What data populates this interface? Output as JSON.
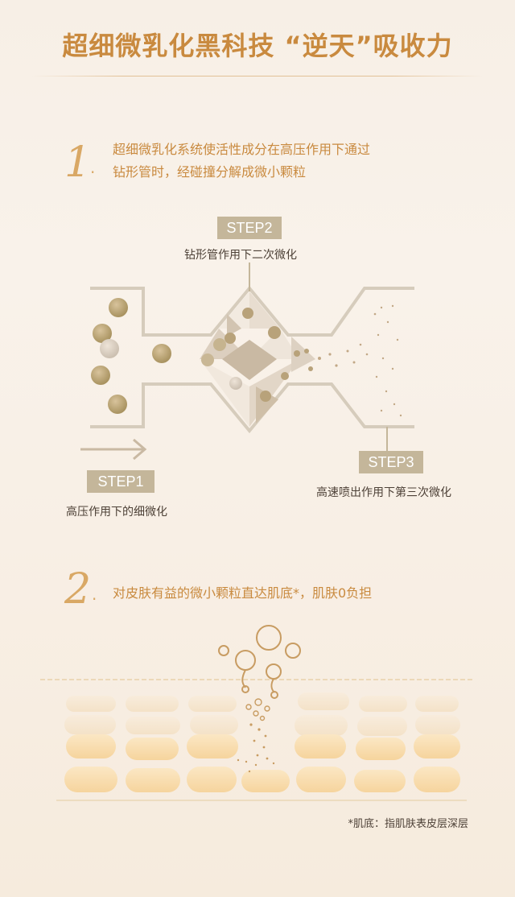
{
  "title": "超细微乳化黑科技 “逆天”吸收力",
  "section1": {
    "number": "1",
    "text_line1": "超细微乳化系统使活性成分在高压作用下通过",
    "text_line2": "钻形管时，经碰撞分解成微小颗粒"
  },
  "steps": {
    "step1": {
      "label": "STEP1",
      "desc": "高压作用下的细微化"
    },
    "step2": {
      "label": "STEP2",
      "desc": "钻形管作用下二次微化"
    },
    "step3": {
      "label": "STEP3",
      "desc": "高速喷出作用下第三次微化"
    }
  },
  "section2": {
    "number": "2",
    "text": "对皮肤有益的微小颗粒直达肌底*，肌肤0负担"
  },
  "footnote": "*肌底：指肌肤表皮层深层",
  "colors": {
    "accent": "#c98a3f",
    "number": "#d9a865",
    "step_label_bg": "#c4b69a",
    "particle": "#b8a27a",
    "cell": "#f8dcae"
  }
}
